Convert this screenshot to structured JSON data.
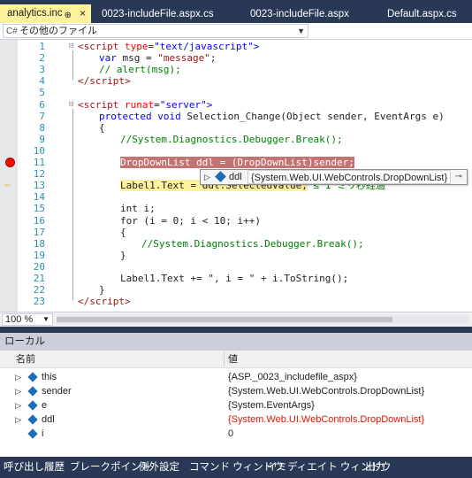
{
  "tabs": [
    {
      "label": "analytics.inc",
      "active": true
    },
    {
      "label": "0023-includeFile.aspx.cs",
      "active": false
    },
    {
      "label": "0023-includeFile.aspx",
      "active": false
    },
    {
      "label": "Default.aspx.cs",
      "active": false
    }
  ],
  "tab_pin_glyph": "⊕",
  "tab_close_glyph": "×",
  "navbar": {
    "scope": "その他のファイル"
  },
  "editor": {
    "line_numbers": [
      "1",
      "2",
      "3",
      "4",
      "5",
      "6",
      "7",
      "8",
      "9",
      "10",
      "11",
      "12",
      "13",
      "14",
      "15",
      "16",
      "17",
      "18",
      "19",
      "20",
      "21",
      "22",
      "23"
    ],
    "lines": {
      "l1_a": "<script ",
      "l1_b": "type",
      "l1_c": "=\"",
      "l1_d": "text/javascript",
      "l1_e": "\">",
      "l2_a": "var ",
      "l2_b": "msg",
      "l2_c": " = ",
      "l2_d": "\"message\"",
      "l2_e": ";",
      "l3": "// alert(msg);",
      "l4_a": "</",
      "l4_b": "script",
      "l4_c": ">",
      "l6_a": "<script ",
      "l6_b": "runat",
      "l6_c": "=\"",
      "l6_d": "server",
      "l6_e": "\">",
      "l7_a": "protected ",
      "l7_b": "void ",
      "l7_c": "Selection_Change(Object sender, EventArgs e)",
      "l8": "{",
      "l9": "//System.Diagnostics.Debugger.Break();",
      "l11": "DropDownList ddl = (DropDownList)sender;",
      "l13_a": "Label1.Text = ddl.SelectedValue;",
      "l13_b": " ≤ 1 ミリ秒経過",
      "l15": "int i;",
      "l16": "for (i = 0; i < 10; i++)",
      "l17": "{",
      "l18": "//System.Diagnostics.Debugger.Break();",
      "l19": "}",
      "l21": "Label1.Text += \", i = \" + i.ToString();",
      "l22": "}",
      "l23_a": "</",
      "l23_b": "script",
      "l23_c": ">"
    }
  },
  "datatip": {
    "expander": "▷",
    "name": "ddl",
    "value": "{System.Web.UI.WebControls.DropDownList}",
    "pin": "⊸"
  },
  "zoom": {
    "value": "100 %"
  },
  "locals": {
    "title": "ローカル",
    "col_name": "名前",
    "col_value": "値",
    "rows": [
      {
        "expandable": true,
        "name": "this",
        "value": "{ASP._0023_includefile_aspx}",
        "changed": false
      },
      {
        "expandable": true,
        "name": "sender",
        "value": "{System.Web.UI.WebControls.DropDownList}",
        "changed": false
      },
      {
        "expandable": true,
        "name": "e",
        "value": "{System.EventArgs}",
        "changed": false
      },
      {
        "expandable": true,
        "name": "ddl",
        "value": "{System.Web.UI.WebControls.DropDownList}",
        "changed": true
      },
      {
        "expandable": false,
        "name": "i",
        "value": "0",
        "changed": false
      }
    ]
  },
  "bottom_tabs": [
    "呼び出し履歴",
    "ブレークポイント",
    "例外設定",
    "コマンド ウィンドウ",
    "イミディエイト ウィンドウ",
    "出力"
  ],
  "colors": {
    "breakpoint": "#e51400",
    "breakpoint_highlight": "#c47373",
    "current_line": "#fff29d",
    "changed_value": "#e51400",
    "chrome": "#293955"
  }
}
